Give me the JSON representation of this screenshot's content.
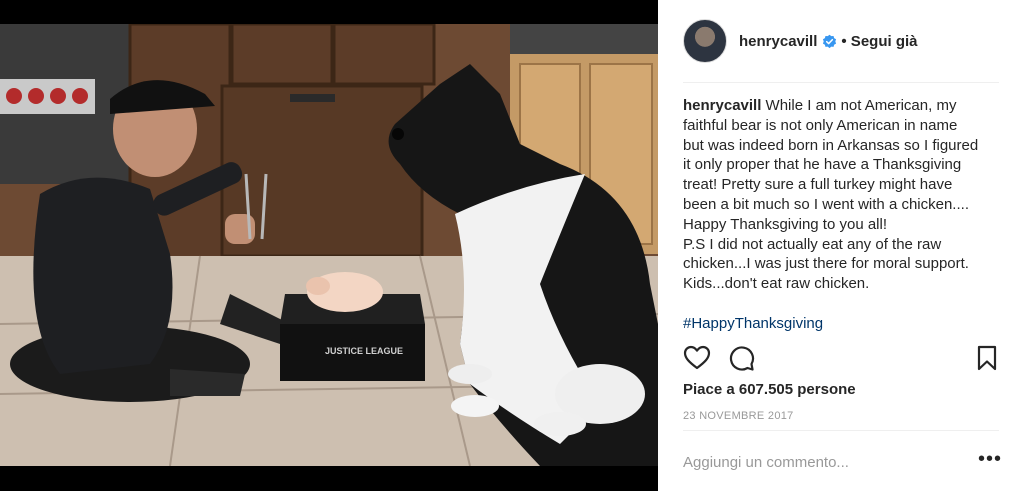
{
  "header": {
    "username": "henrycavill",
    "follow_label": "• Segui già"
  },
  "caption": {
    "username": "henrycavill",
    "text": " While I am not American, my\nfaithful bear is not only American in name\nbut was indeed born in Arkansas so I figured\nit only proper that he have a Thanksgiving\ntreat! Pretty sure a full turkey might have\nbeen a bit much so I went with a chicken....\nHappy Thanksgiving to you all!\nP.S I did not actually eat any of the raw\nchicken...I was just there for moral support.\nKids...don't eat raw chicken.",
    "hashtag": "#HappyThanksgiving"
  },
  "photo": {
    "box_label": "JUSTICE LEAGUE"
  },
  "stats": {
    "likes": "Piace a 607.505 persone",
    "date": "23 NOVEMBRE 2017"
  },
  "comment": {
    "placeholder": "Aggiungi un commento...",
    "more_label": "•••"
  },
  "icons": {
    "like": "heart-icon",
    "comment": "comment-icon",
    "save": "bookmark-icon",
    "verified": "verified-badge-icon",
    "more": "more-options-icon"
  },
  "colors": {
    "verified": "#3897f0",
    "hashtag": "#003569",
    "muted": "#999999",
    "text": "#262626"
  }
}
